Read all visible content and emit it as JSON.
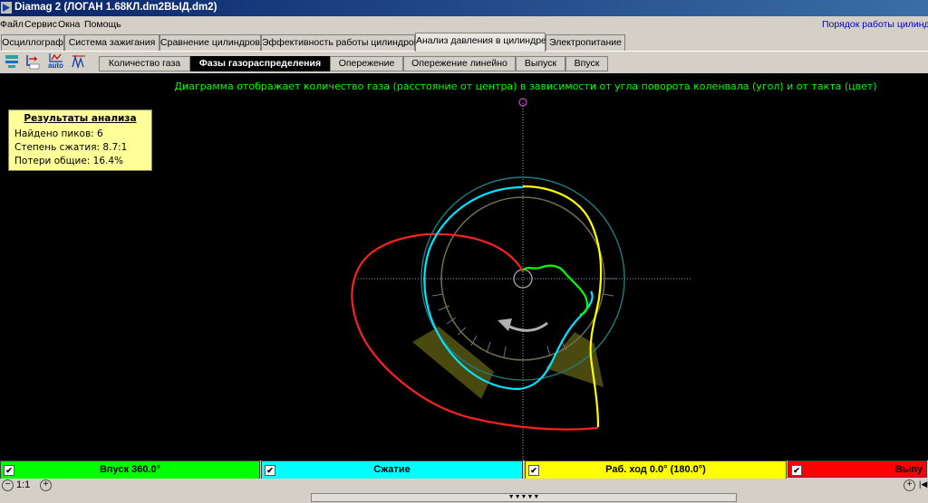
{
  "window": {
    "title": "Diamag 2 (ЛОГАН 1.68КЛ.dm2ВЫД.dm2)"
  },
  "menu": {
    "items": [
      "Файл",
      "Сервис",
      "Окна",
      "Помощь"
    ],
    "right_link": "Порядок работы цилиндров"
  },
  "main_tabs": [
    "Осциллограф",
    "Система зажигания",
    "Сравнение цилиндров",
    "Эффективность работы цилиндров",
    "Анализ давления в цилиндре",
    "Электропитание"
  ],
  "main_tab_active": "Анализ давления в цилиндре",
  "toolbar": {
    "icons": [
      "settings-icon",
      "export-icon",
      "auto-icon",
      "waveform-icon"
    ],
    "auto_label": "auto"
  },
  "sub_tabs": [
    "Количество газа",
    "Фазы газораспределения",
    "Опережение",
    "Опережение линейно",
    "Выпуск",
    "Впуск"
  ],
  "sub_tab_active": "Фазы газораспределения",
  "diagram": {
    "caption": "Диаграмма отображает количество газа (расстояние от центра) в зависимости от угла поворота коленвала (угол) и от такта (цвет)",
    "phase_colors": {
      "intake": "#00ff00",
      "compression": "#00ffff",
      "power": "#ffff00",
      "exhaust": "#ff0000"
    },
    "rotation_direction": "counterclockwise"
  },
  "results": {
    "title": "Результаты анализа",
    "lines": [
      "Найдено пиков: 6",
      "Степень сжатия: 8.7:1",
      "Потери общие: 16.4%"
    ]
  },
  "legend": [
    {
      "label": "Впуск 360.0°",
      "color": "#00ff00",
      "checked": true
    },
    {
      "label": "Сжатие",
      "color": "#00ffff",
      "checked": true
    },
    {
      "label": "Раб. ход 0.0° (180.0°)",
      "color": "#ffff00",
      "checked": true
    },
    {
      "label": "Выпу",
      "color": "#ff0000",
      "checked": true
    }
  ],
  "status": {
    "zoom": "1:1"
  }
}
